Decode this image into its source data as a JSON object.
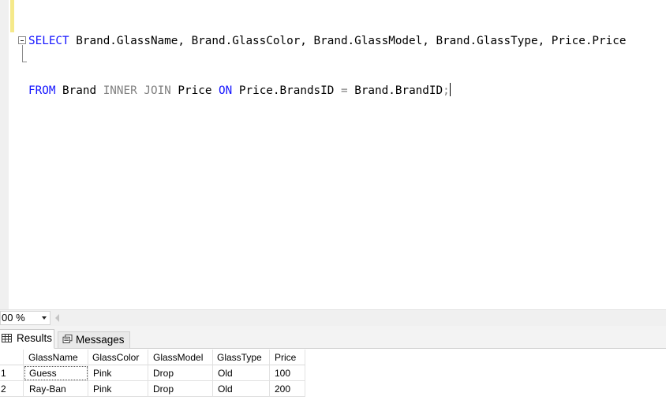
{
  "editor": {
    "lines": [
      {
        "tokens": [
          {
            "text": "SELECT",
            "kind": "kw"
          },
          {
            "text": " Brand.GlassName, Brand.GlassColor, Brand.GlassModel, Brand.GlassType, Price.Price",
            "kind": "id"
          }
        ]
      },
      {
        "tokens": [
          {
            "text": "FROM",
            "kind": "kw"
          },
          {
            "text": " Brand ",
            "kind": "id"
          },
          {
            "text": "INNER JOIN",
            "kind": "kw-gray"
          },
          {
            "text": " Price ",
            "kind": "id"
          },
          {
            "text": "ON",
            "kind": "kw"
          },
          {
            "text": " Price.BrandsID ",
            "kind": "id"
          },
          {
            "text": "=",
            "kind": "kw-gray"
          },
          {
            "text": " Brand.BrandID",
            "kind": "id"
          },
          {
            "text": ";",
            "kind": "kw-gray"
          }
        ]
      }
    ]
  },
  "statusbar": {
    "zoom": "00 %"
  },
  "tabs": {
    "results_label": "Results",
    "messages_label": "Messages"
  },
  "results": {
    "columns": [
      "GlassName",
      "GlassColor",
      "GlassModel",
      "GlassType",
      "Price"
    ],
    "rows": [
      {
        "num": "1",
        "cells": [
          "Guess",
          "Pink",
          "Drop",
          "Old",
          "100"
        ]
      },
      {
        "num": "2",
        "cells": [
          "Ray-Ban",
          "Pink",
          "Drop",
          "Old",
          "200"
        ]
      }
    ]
  },
  "colors": {
    "keyword": "#1414ff",
    "operator": "#808080",
    "change_bar": "#f5e98a"
  }
}
